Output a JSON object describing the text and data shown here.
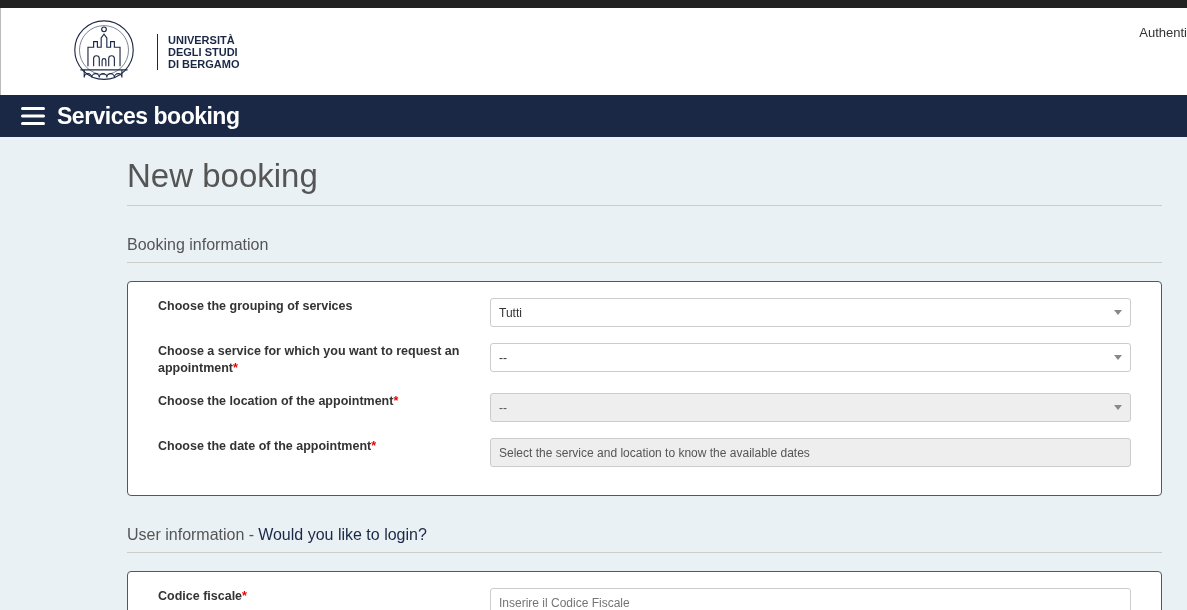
{
  "header": {
    "logo_text": [
      "UNIVERSITÀ",
      "DEGLI STUDI",
      "DI BERGAMO"
    ],
    "auth_link": "Authenti"
  },
  "navbar": {
    "title": "Services booking"
  },
  "page": {
    "title": "New booking"
  },
  "sections": [
    {
      "title": "Booking information",
      "fields": [
        {
          "label": "Choose the grouping of services",
          "kind": "select",
          "value": "Tutti",
          "disabled": false
        },
        {
          "label": "Choose a service for which you want to request an appointment",
          "required_mark": "*",
          "kind": "select",
          "value": "--",
          "disabled": false
        },
        {
          "label": "Choose the location of the appointment",
          "required_mark": "*",
          "kind": "select",
          "value": "--",
          "disabled": true
        },
        {
          "label": "Choose the date of the appointment",
          "required_mark": "*",
          "kind": "text",
          "value": "Select the service and location to know the available dates",
          "disabled": true
        }
      ]
    },
    {
      "title": "User information -",
      "link": "Would you like to login?",
      "fields": [
        {
          "label": "Codice fiscale",
          "required_mark": "*",
          "kind": "text",
          "placeholder": "Inserire il Codice Fiscale",
          "disabled": false
        }
      ]
    }
  ]
}
